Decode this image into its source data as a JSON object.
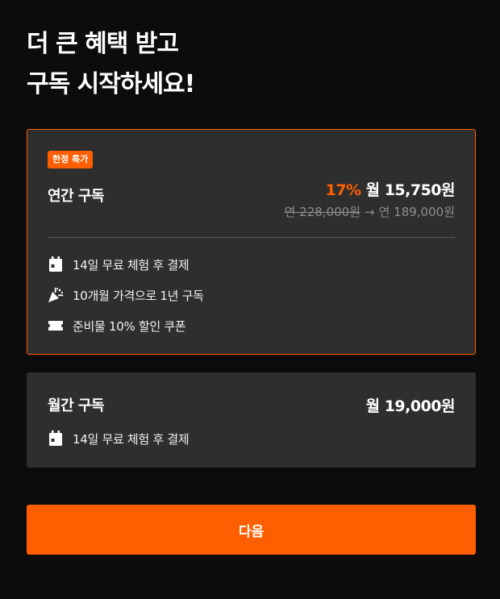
{
  "headline": {
    "line1": "더 큰 혜택 받고",
    "line2": "구독 시작하세요!"
  },
  "annual_plan": {
    "badge": "한정 특가",
    "title": "연간 구독",
    "discount": "17%",
    "price": "월 15,750원",
    "original_price": "연 228,000원",
    "arrow": "→",
    "discounted_price": "연 189,000원",
    "selected": true,
    "features": [
      {
        "icon": "calendar-icon",
        "text": "14일 무료 체험 후 결제"
      },
      {
        "icon": "party-popper-icon",
        "text": "10개월 가격으로 1년 구독"
      },
      {
        "icon": "ticket-icon",
        "text": "준비물 10% 할인 쿠폰"
      }
    ]
  },
  "monthly_plan": {
    "title": "월간 구독",
    "price": "월 19,000원",
    "selected": false,
    "features": [
      {
        "icon": "calendar-icon",
        "text": "14일 무료 체험 후 결제"
      }
    ]
  },
  "next_button": {
    "label": "다음"
  },
  "colors": {
    "accent": "#ff5f00",
    "background": "#0c0c0c",
    "card": "#2e2e2e",
    "muted_text": "#8e8e8e"
  }
}
